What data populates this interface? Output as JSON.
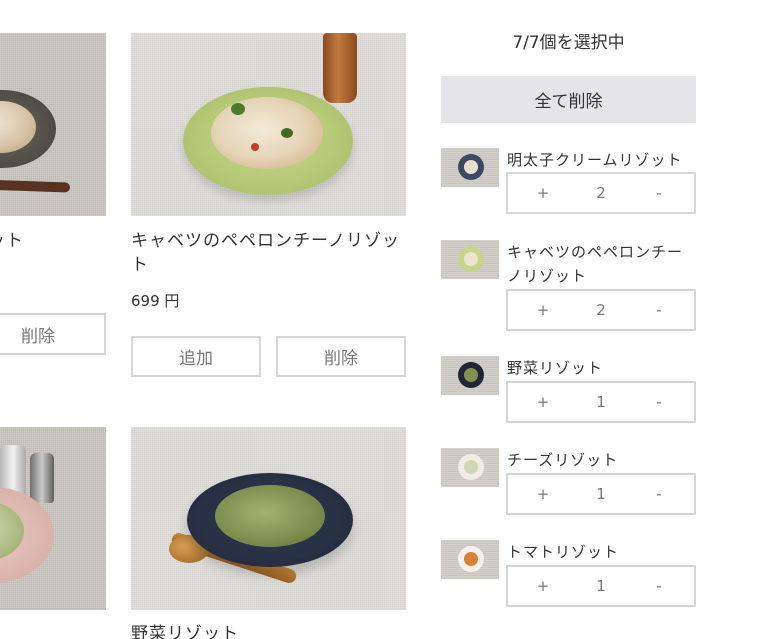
{
  "products": [
    {
      "name": "ゾット",
      "remove_label": "削除"
    },
    {
      "name": "キャベツのペペロンチーノリゾット",
      "price": "699 円",
      "add_label": "追加",
      "remove_label": "削除"
    },
    {
      "name": ""
    },
    {
      "name": "野菜リゾット"
    }
  ],
  "cart": {
    "count_text": "7/7個を選択中",
    "clear_all_label": "全て削除",
    "items": [
      {
        "name": "明太子クリームリゾット",
        "plus": "+",
        "qty": "2",
        "minus": "-"
      },
      {
        "name": "キャベツのペペロンチーノリゾット",
        "plus": "+",
        "qty": "2",
        "minus": "-"
      },
      {
        "name": "野菜リゾット",
        "plus": "+",
        "qty": "1",
        "minus": "-"
      },
      {
        "name": "チーズリゾット",
        "plus": "+",
        "qty": "1",
        "minus": "-"
      },
      {
        "name": "トマトリゾット",
        "plus": "+",
        "qty": "1",
        "minus": "-"
      }
    ]
  },
  "colors": {
    "border": "#d6d6d6",
    "button_gray": "#e5e5e8",
    "text": "#333333",
    "muted_text": "#777777"
  }
}
